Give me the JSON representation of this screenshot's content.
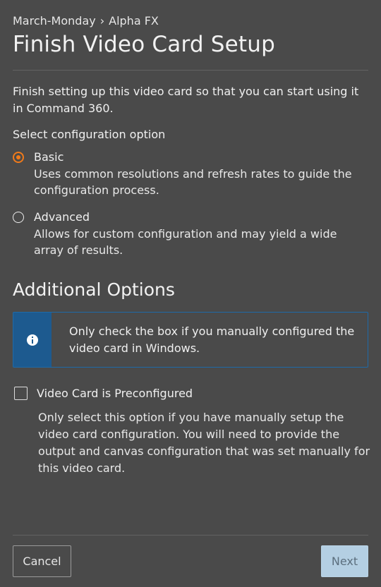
{
  "breadcrumb": {
    "parent": "March-Monday",
    "separator": "›",
    "current": "Alpha FX"
  },
  "page_title": "Finish Video Card Setup",
  "intro_text": "Finish setting up this video card so that you can start using it in Command 360.",
  "configuration": {
    "label": "Select configuration option",
    "selected": "Basic",
    "options": [
      {
        "title": "Basic",
        "description": "Uses common resolutions and refresh rates to guide the configuration process."
      },
      {
        "title": "Advanced",
        "description": "Allows for custom configuration and may yield a wide array of results."
      }
    ]
  },
  "additional_options": {
    "title": "Additional Options",
    "info_icon": "info-circle-icon",
    "info_text": "Only check the box if you manually configured the video card in Windows.",
    "checkbox": {
      "label": "Video Card is Preconfigured",
      "checked": false,
      "description": "Only select this option if you have manually setup the video card configuration. You will need to provide the output and canvas configuration that was set manually for this video card."
    }
  },
  "footer": {
    "cancel_label": "Cancel",
    "next_label": "Next"
  },
  "colors": {
    "background": "#4a4a4a",
    "accent_radio": "#f07a1a",
    "info_strip": "#1d5a8f",
    "next_button_bg": "#b4cfe3"
  }
}
